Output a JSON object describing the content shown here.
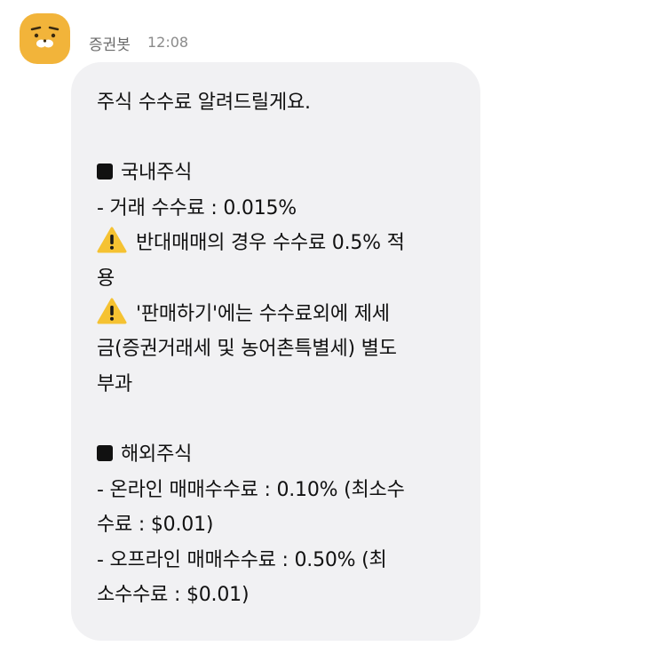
{
  "sender": {
    "name": "증권봇",
    "time": "12:08"
  },
  "message": {
    "intro": "주식 수수료 알려드릴게요.",
    "domestic": {
      "header": "국내주식",
      "fee_line": "- 거래 수수료 : 0.015%",
      "warning1_line1": "반대매매의 경우 수수료 0.5% 적",
      "warning1_line2": "용",
      "warning2_line1": "'판매하기'에는 수수료외에 제세",
      "warning2_line2": "금(증권거래세 및 농어촌특별세) 별도",
      "warning2_line3": "부과"
    },
    "overseas": {
      "header": "해외주식",
      "online_line1": "- 온라인 매매수수료 : 0.10% (최소수",
      "online_line2": "수료 : $0.01)",
      "offline_line1": "- 오프라인 매매수수료 : 0.50% (최",
      "offline_line2": "소수수료 : $0.01)"
    }
  },
  "icons": {
    "avatar": "ryan-character-avatar",
    "bullet": "black-square-icon",
    "warning": "warning-icon"
  },
  "colors": {
    "avatar_bg": "#f2b43a",
    "bubble_bg": "#f1f1f3",
    "warning_fill": "#f5c232"
  }
}
